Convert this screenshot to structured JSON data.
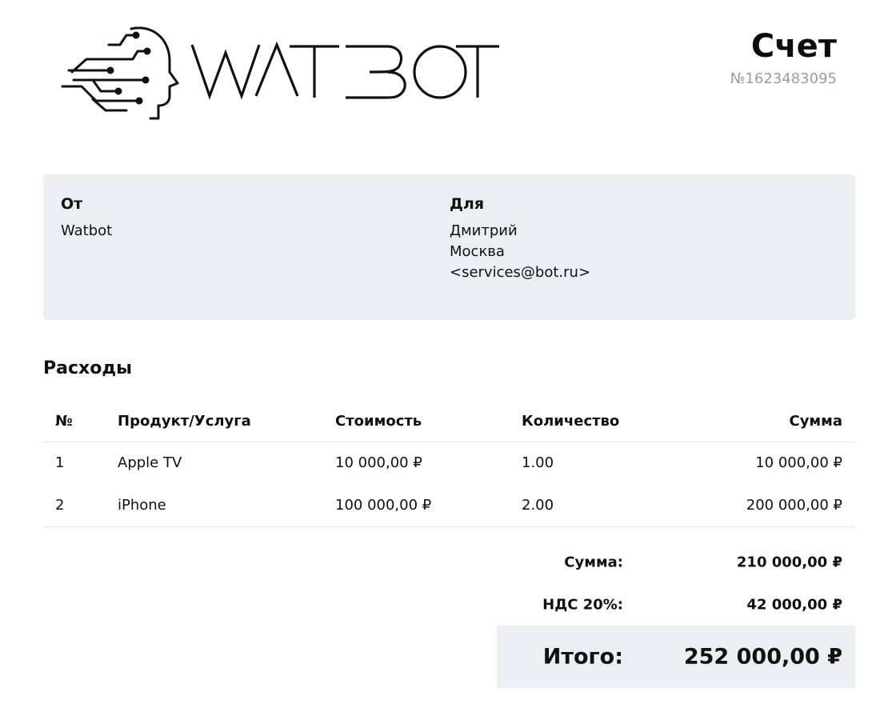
{
  "brand": {
    "name": "WATBOT"
  },
  "document": {
    "title": "Счет",
    "number": "№1623483095"
  },
  "from": {
    "heading": "От",
    "lines": [
      "Watbot"
    ]
  },
  "to": {
    "heading": "Для",
    "lines": [
      "Дмитрий",
      "Москва",
      "<services@bot.ru>"
    ]
  },
  "expenses": {
    "title": "Расходы",
    "headers": [
      "№",
      "Продукт/Услуга",
      "Стоимость",
      "Количество",
      "Сумма"
    ],
    "rows": [
      [
        "1",
        "Apple TV",
        "10 000,00 ₽",
        "1.00",
        "10 000,00 ₽"
      ],
      [
        "2",
        "iPhone",
        "100 000,00 ₽",
        "2.00",
        "200 000,00 ₽"
      ]
    ]
  },
  "totals": {
    "subtotal_label": "Сумма:",
    "subtotal_value": "210 000,00 ₽",
    "vat_label": "НДС 20%:",
    "vat_value": "42 000,00 ₽",
    "total_label": "Итого:",
    "total_value": "252 000,00 ₽"
  }
}
